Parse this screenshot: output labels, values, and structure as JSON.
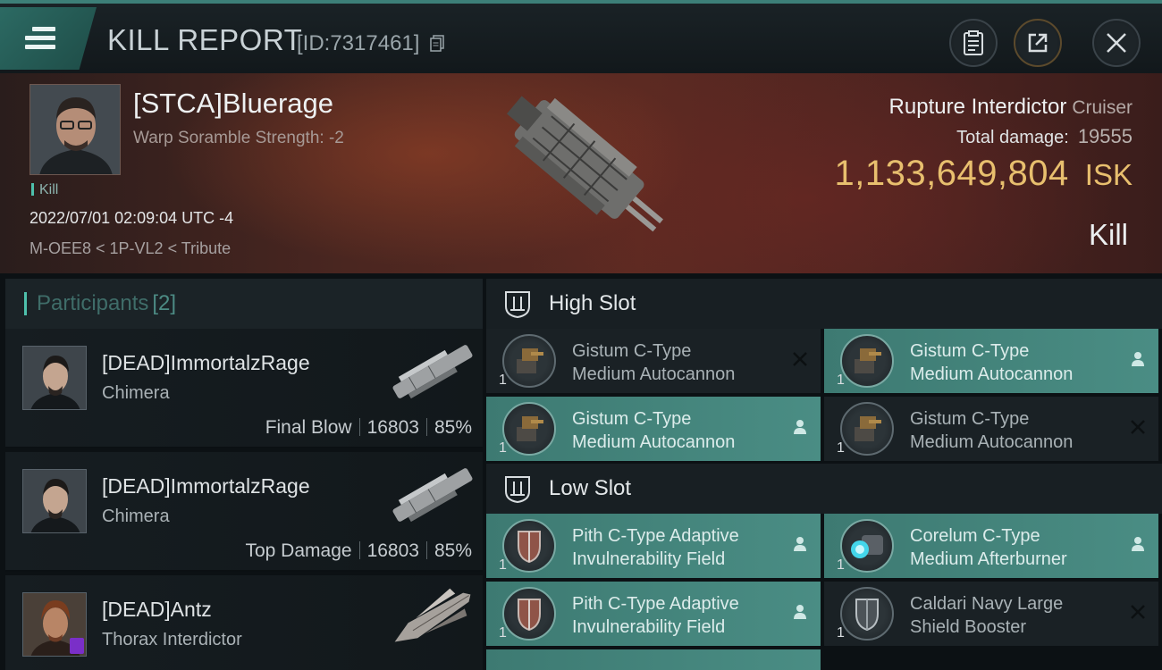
{
  "header": {
    "title": "KILL REPORT",
    "report_id": "[ID:7317461]"
  },
  "victim": {
    "name": "[STCA]Bluerage",
    "subtitle": "Warp Soramble Strength: -2",
    "tag": "Kill",
    "timestamp": "2022/07/01 02:09:04 UTC -4",
    "location": "M-OEE8 < 1P-VL2 < Tribute",
    "ship_name": "Rupture Interdictor",
    "ship_class": "Cruiser",
    "total_damage_label": "Total damage:",
    "total_damage_value": "19555",
    "isk_value": "1,133,649,804",
    "isk_unit": "ISK",
    "outcome": "Kill"
  },
  "participants": {
    "title": "Participants",
    "count": "[2]",
    "rows": [
      {
        "name": "[DEAD]ImmortalzRage",
        "ship": "Chimera",
        "role": "Final Blow",
        "damage": "16803",
        "percent": "85%"
      },
      {
        "name": "[DEAD]ImmortalzRage",
        "ship": "Chimera",
        "role": "Top Damage",
        "damage": "16803",
        "percent": "85%"
      },
      {
        "name": "[DEAD]Antz",
        "ship": "Thorax Interdictor"
      }
    ]
  },
  "fitting": {
    "high_slot_title": "High Slot",
    "low_slot_title": "Low Slot",
    "high": [
      {
        "line1": "Gistum C-Type",
        "line2": "Medium Autocannon",
        "qty": "1",
        "state": "destroyed"
      },
      {
        "line1": "Gistum C-Type",
        "line2": "Medium Autocannon",
        "qty": "1",
        "state": "dropped"
      },
      {
        "line1": "Gistum C-Type",
        "line2": "Medium Autocannon",
        "qty": "1",
        "state": "dropped"
      },
      {
        "line1": "Gistum C-Type",
        "line2": "Medium Autocannon",
        "qty": "1",
        "state": "destroyed"
      }
    ],
    "low": [
      {
        "line1": "Pith C-Type Adaptive",
        "line2": "Invulnerability Field",
        "qty": "1",
        "state": "dropped"
      },
      {
        "line1": "Corelum C-Type",
        "line2": "Medium Afterburner",
        "qty": "1",
        "state": "dropped"
      },
      {
        "line1": "Pith C-Type Adaptive",
        "line2": "Invulnerability Field",
        "qty": "1",
        "state": "dropped"
      },
      {
        "line1": "Caldari Navy Large",
        "line2": "Shield Booster",
        "qty": "1",
        "state": "destroyed"
      }
    ]
  },
  "colors": {
    "accent": "#4ec0ac",
    "isk_gold": "#e8bf6e",
    "dropped_bg": "#4a8d84"
  }
}
